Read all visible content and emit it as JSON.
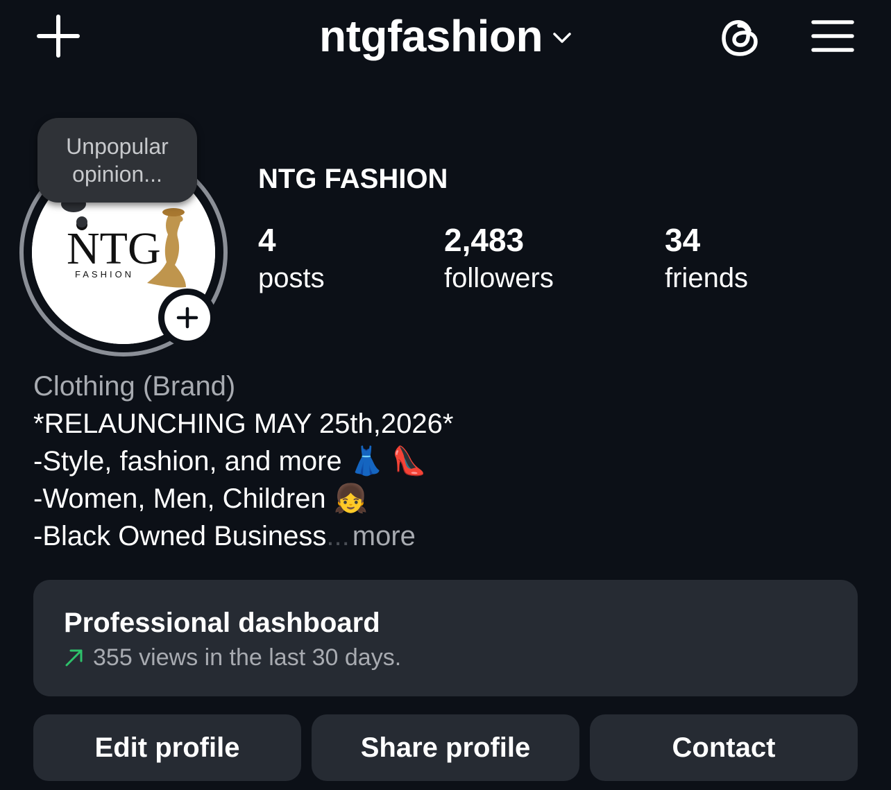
{
  "header": {
    "username": "ntgfashion",
    "icons": {
      "create": "plus-icon",
      "account_switch": "chevron-down-icon",
      "threads": "threads-icon",
      "menu": "hamburger-menu-icon"
    }
  },
  "note": {
    "text": "Unpopular opinion..."
  },
  "avatar": {
    "logo_main": "NTG",
    "logo_sub": "FASHION",
    "add_icon": "plus-icon"
  },
  "profile": {
    "display_name": "NTG FASHION",
    "stats": [
      {
        "value": "4",
        "label": "posts"
      },
      {
        "value": "2,483",
        "label": "followers"
      },
      {
        "value": "34",
        "label": "friends"
      }
    ]
  },
  "bio": {
    "category": "Clothing (Brand)",
    "lines": [
      "*RELAUNCHING MAY 25th,2026*",
      "-Style, fashion, and more",
      "-Women, Men, Children",
      "-Black Owned Business"
    ],
    "emojis": [
      "👗",
      "👠",
      "👧"
    ],
    "ellipsis": "...",
    "more_label": "more"
  },
  "dashboard": {
    "title": "Professional dashboard",
    "subtitle": "355 views in the last 30 days.",
    "trend_icon": "trend-up-arrow-icon",
    "trend_color": "#2ec26b"
  },
  "buttons": {
    "edit": "Edit profile",
    "share": "Share profile",
    "contact": "Contact"
  },
  "colors": {
    "background": "#0c1017",
    "card": "#262b33",
    "secondary_text": "#a8abb1",
    "logo_gold": "#b8893a"
  }
}
